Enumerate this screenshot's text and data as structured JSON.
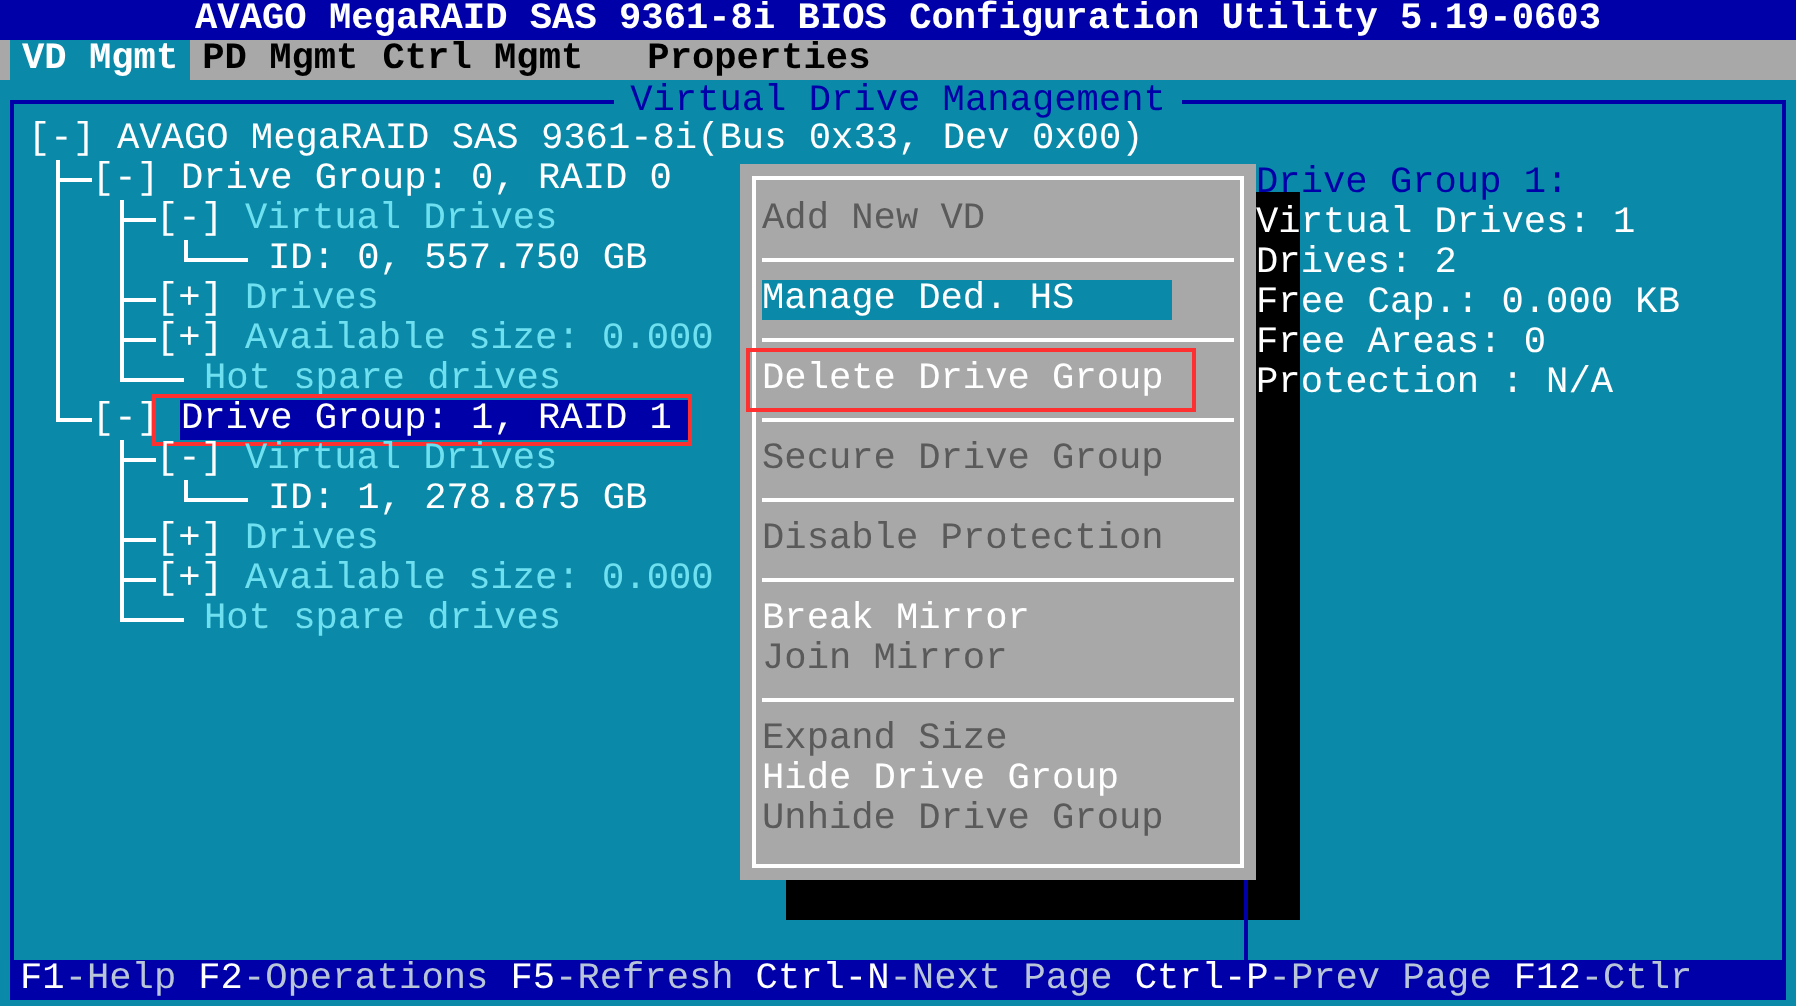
{
  "window": {
    "title": "AVAGO MegaRAID SAS 9361-8i BIOS Configuration Utility 5.19-0603"
  },
  "tabs": [
    {
      "label": "VD Mgmt",
      "selected": true
    },
    {
      "label": "PD Mgmt",
      "selected": false
    },
    {
      "label": "Ctrl Mgmt",
      "selected": false
    },
    {
      "label": "Properties",
      "selected": false
    }
  ],
  "panel": {
    "title": "Virtual Drive Management"
  },
  "tree": [
    {
      "toggle": "[-]",
      "label": "AVAGO MegaRAID SAS 9361-8i(Bus 0x33, Dev 0x00)",
      "color": "#ffffff",
      "selected": false,
      "annotated": false,
      "children": [
        {
          "toggle": "[-]",
          "label": "Drive Group: 0, RAID 0",
          "color": "#ffffff",
          "selected": false,
          "annotated": false,
          "children": [
            {
              "toggle": "[-]",
              "label": "Virtual Drives",
              "color": "#6ee0f0",
              "selected": false,
              "annotated": false,
              "children": [
                {
                  "label": "ID: 0, 557.750 GB",
                  "color": "#ffffff",
                  "selected": false,
                  "annotated": false
                }
              ]
            },
            {
              "toggle": "[+]",
              "label": "Drives",
              "color": "#6ee0f0",
              "selected": false,
              "annotated": false
            },
            {
              "toggle": "[+]",
              "label": "Available size: 0.000",
              "color": "#6ee0f0",
              "selected": false,
              "annotated": false
            },
            {
              "label": "Hot spare drives",
              "color": "#6ee0f0",
              "selected": false,
              "annotated": false
            }
          ]
        },
        {
          "toggle": "[-]",
          "label": "Drive Group: 1, RAID 1",
          "selected": true,
          "annotated": true,
          "children": [
            {
              "toggle": "[-]",
              "label": "Virtual Drives",
              "color": "#6ee0f0",
              "selected": false,
              "annotated": false,
              "children": [
                {
                  "label": "ID: 1, 278.875 GB",
                  "color": "#ffffff",
                  "selected": false,
                  "annotated": false
                }
              ]
            },
            {
              "toggle": "[+]",
              "label": "Drives",
              "color": "#6ee0f0",
              "selected": false,
              "annotated": false
            },
            {
              "toggle": "[+]",
              "label": "Available size: 0.000",
              "color": "#6ee0f0",
              "selected": false,
              "annotated": false
            },
            {
              "label": "Hot spare drives",
              "color": "#6ee0f0",
              "selected": false,
              "annotated": false
            }
          ]
        }
      ]
    }
  ],
  "menu": {
    "sections": [
      [
        {
          "label": "Add New VD",
          "disabled": true,
          "selected": false,
          "annotated": false
        }
      ],
      [
        {
          "label": "Manage Ded. HS",
          "disabled": false,
          "selected": true,
          "annotated": false
        }
      ],
      [
        {
          "label": "Delete Drive Group",
          "disabled": false,
          "selected": false,
          "annotated": true
        }
      ],
      [
        {
          "label": "Secure Drive Group",
          "disabled": true,
          "selected": false,
          "annotated": false
        }
      ],
      [
        {
          "label": "Disable Protection",
          "disabled": true,
          "selected": false,
          "annotated": false
        }
      ],
      [
        {
          "label": "Break Mirror",
          "disabled": false,
          "selected": false,
          "annotated": false
        },
        {
          "label": "Join Mirror",
          "disabled": true,
          "selected": false,
          "annotated": false
        }
      ],
      [
        {
          "label": "Expand Size",
          "disabled": true,
          "selected": false,
          "annotated": false
        },
        {
          "label": "Hide Drive Group",
          "disabled": false,
          "selected": false,
          "annotated": false
        },
        {
          "label": "Unhide Drive Group",
          "disabled": true,
          "selected": false,
          "annotated": false
        }
      ]
    ]
  },
  "info": {
    "title": "Drive Group 1:",
    "lines": [
      "Virtual Drives: 1",
      "Drives: 2",
      "Free Cap.: 0.000 KB",
      "Free Areas: 0",
      "Protection : N/A"
    ]
  },
  "status_bar": [
    {
      "key": "F1",
      "action": "-Help"
    },
    {
      "key": "F2",
      "action": "-Operations"
    },
    {
      "key": "F5",
      "action": "-Refresh"
    },
    {
      "key": "Ctrl-N",
      "action": "-Next Page"
    },
    {
      "key": "Ctrl-P",
      "action": "-Prev Page"
    },
    {
      "key": "F12",
      "action": "-Ctlr"
    }
  ]
}
